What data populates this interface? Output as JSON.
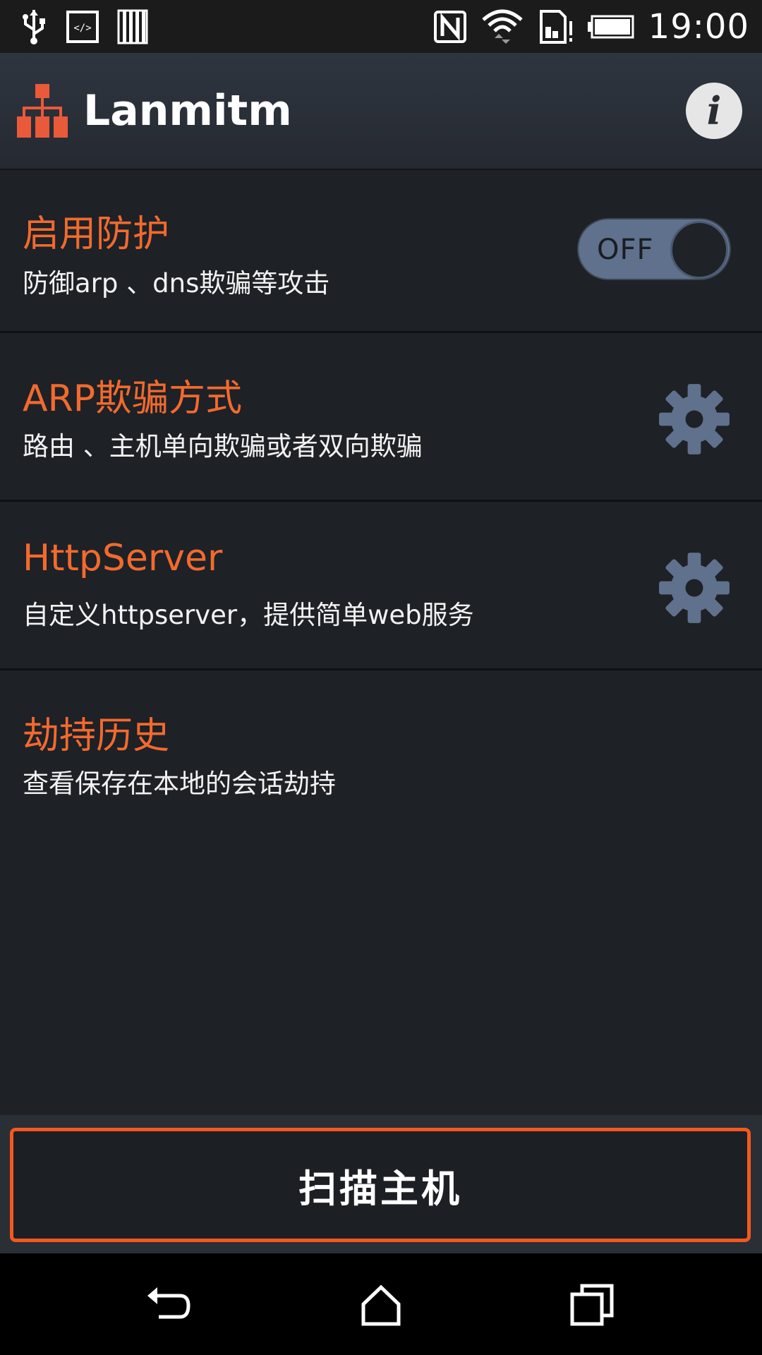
{
  "status_bar": {
    "time": "19:00",
    "icons": [
      "usb-icon",
      "developer-icon",
      "storage-icon",
      "nfc-icon",
      "wifi-icon",
      "sim-icon",
      "battery-icon"
    ]
  },
  "app_bar": {
    "title": "Lanmitm",
    "logo": "network-icon",
    "info_icon": "info-icon",
    "info_glyph": "i"
  },
  "colors": {
    "accent": "#f26a2e",
    "background": "#1e2126",
    "toggle": "#5f718c"
  },
  "settings": [
    {
      "title": "启用防护",
      "subtitle": "防御arp 、dns欺骗等攻击",
      "control": "toggle",
      "toggle_label": "OFF"
    },
    {
      "title": "ARP欺骗方式",
      "subtitle": "路由 、主机单向欺骗或者双向欺骗",
      "control": "gear-icon"
    },
    {
      "title": "HttpServer",
      "subtitle": "自定义httpserver，提供简单web服务",
      "control": "gear-icon"
    },
    {
      "title": "劫持历史",
      "subtitle": "查看保存在本地的会话劫持",
      "control": "none"
    }
  ],
  "scan_button": {
    "label": "扫描主机"
  },
  "nav_bar": {
    "back": "back-icon",
    "home": "home-icon",
    "recent": "recent-apps-icon"
  }
}
